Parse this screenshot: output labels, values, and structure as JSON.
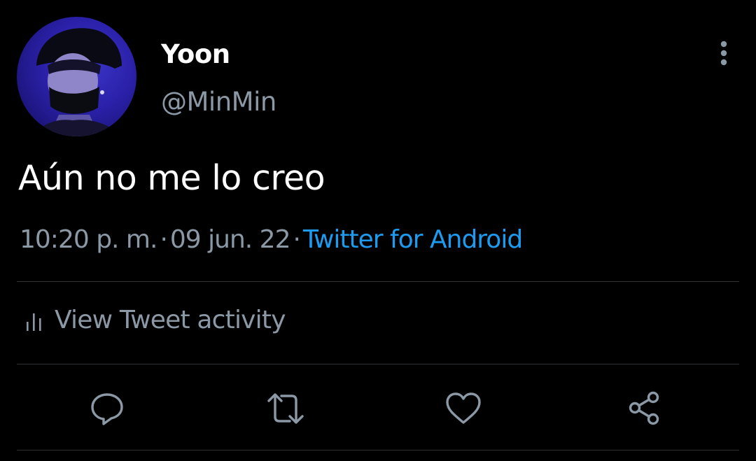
{
  "author": {
    "name": "Yoon",
    "handle": "@MinMin"
  },
  "tweet": {
    "text": "Aún no me lo creo",
    "time": "10:20 p. m.",
    "separator": "·",
    "date": "09 jun. 22",
    "source": "Twitter for Android"
  },
  "activity": {
    "label": "View Tweet activity"
  },
  "icons": {
    "more": "more-vertical-icon",
    "activity": "bar-chart-icon",
    "reply": "reply-icon",
    "retweet": "retweet-icon",
    "like": "heart-icon",
    "share": "share-icon"
  },
  "colors": {
    "background": "#000000",
    "text_primary": "#ffffff",
    "text_secondary": "#8b98a5",
    "link": "#1d9bf0",
    "divider": "#2f3336"
  }
}
